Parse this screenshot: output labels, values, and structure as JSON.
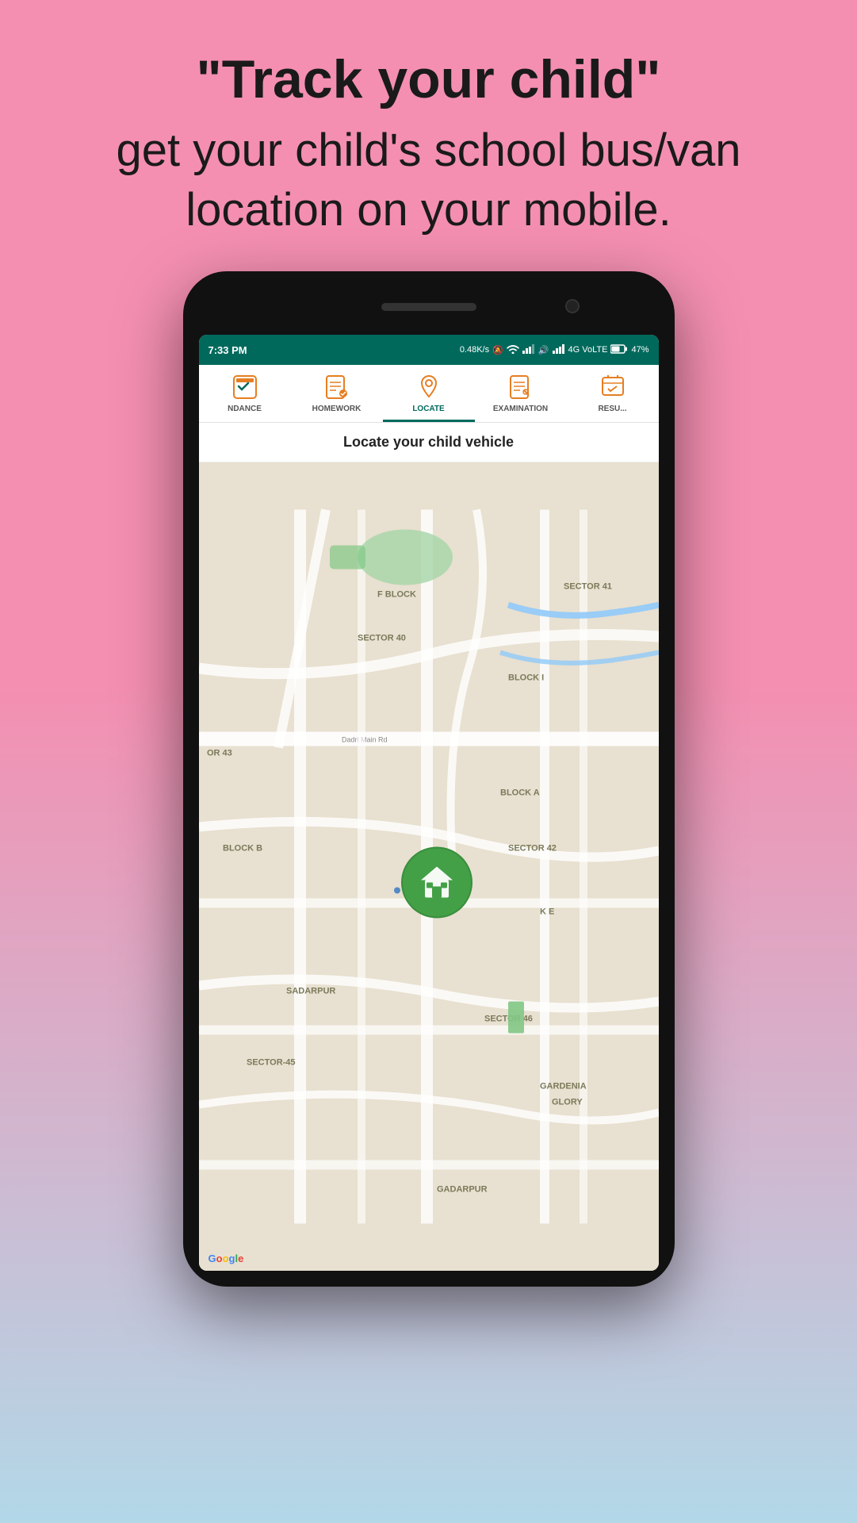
{
  "hero": {
    "line1": "\"Track your child\"",
    "line2": "get your child's school bus/van",
    "line3": "location on your mobile."
  },
  "status_bar": {
    "time": "7:33 PM",
    "network_speed": "0.48K/s",
    "network_type": "4G VoLTE",
    "battery": "47%"
  },
  "nav_tabs": [
    {
      "id": "attendance",
      "label": "NDANCE",
      "active": false
    },
    {
      "id": "homework",
      "label": "HOMEWORK",
      "active": false
    },
    {
      "id": "locate",
      "label": "LOCATE",
      "active": true
    },
    {
      "id": "examination",
      "label": "EXAMINATION",
      "active": false
    },
    {
      "id": "result",
      "label": "RESU...",
      "active": false
    }
  ],
  "page_title": "Locate your child vehicle",
  "map": {
    "labels": [
      "F BLOCK",
      "SECTOR 41",
      "SECTOR 40",
      "BLOCK I",
      "Dadri Main Rd",
      "OR 43",
      "BLOCK A",
      "BLOCK B",
      "SECTOR 42",
      "K E",
      "SADARPUR",
      "SECTOR 46",
      "SECTOR-45",
      "GARDENIA\nGLORY",
      "GADARPUR"
    ]
  },
  "google_watermark": "Google"
}
